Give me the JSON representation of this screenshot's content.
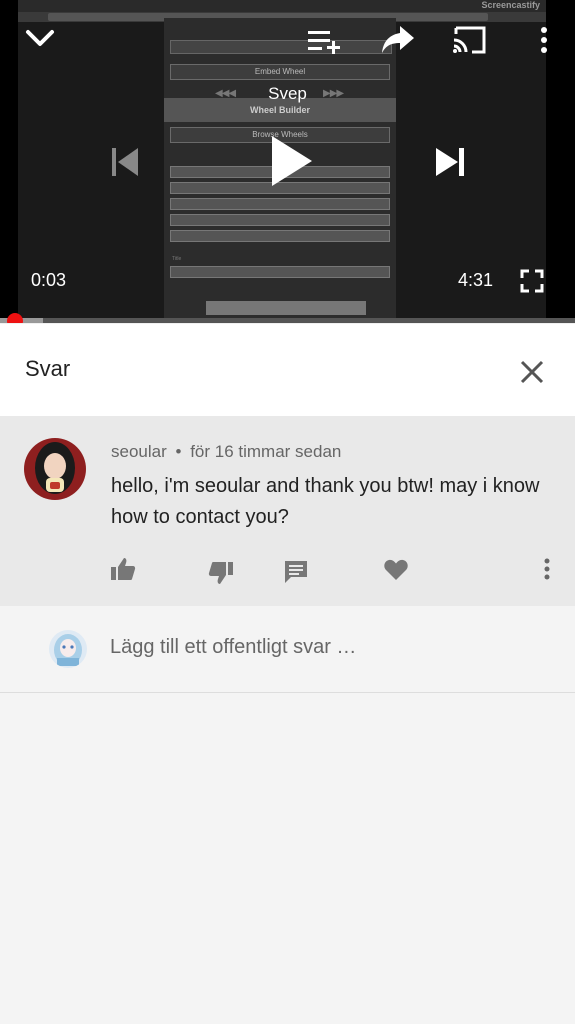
{
  "player": {
    "swipe_label": "Svep",
    "time_current": "0:03",
    "time_total": "4:31",
    "progress_fraction": 0.011,
    "buffer_fraction": 0.075
  },
  "screen_content": {
    "browser_tabs": [
      "",
      "",
      "",
      "",
      "",
      ""
    ],
    "screencastify_label": "Screencastify",
    "embed_wheel": "Embed Wheel",
    "wheel_builder": "Wheel Builder",
    "browse_wheels": "Browse Wheels",
    "title_label": "Title"
  },
  "reply_panel": {
    "title": "Svar"
  },
  "comment": {
    "author": "seoular",
    "separator": "•",
    "time_ago": "för 16 timmar sedan",
    "text": "hello, i'm seoular and thank you btw! may i know how to contact you?"
  },
  "add_reply": {
    "placeholder": "Lägg till ett offentligt svar …"
  },
  "colors": {
    "progress_red": "#ee1111",
    "comment_bg": "#e9e9e9",
    "page_bg": "#f4f4f4"
  }
}
